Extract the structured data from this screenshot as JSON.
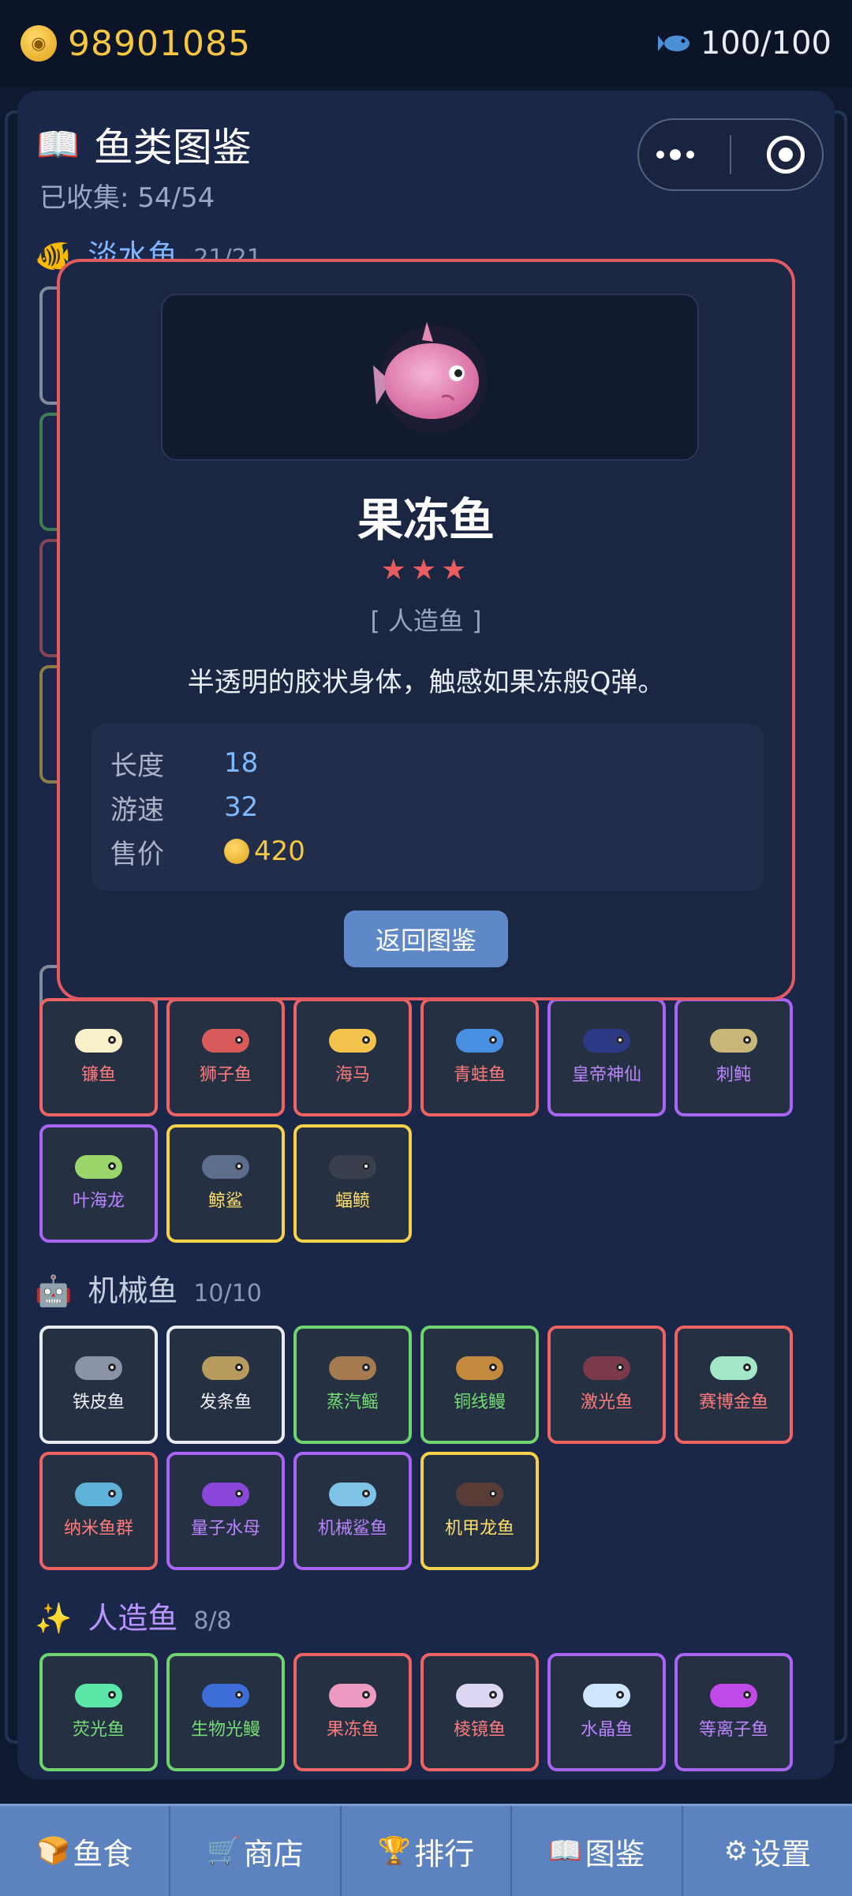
{
  "topbar": {
    "coins": "98901085",
    "fish_capacity": "100/100"
  },
  "album": {
    "title": "鱼类图鉴",
    "collected": "已收集: 54/54",
    "sections": {
      "freshwater": {
        "name": "淡水鱼",
        "count": "21/21"
      },
      "mechanical": {
        "name": "机械鱼",
        "count": "10/10"
      },
      "artificial": {
        "name": "人造鱼",
        "count": "8/8"
      }
    },
    "sea_row1": [
      {
        "name": "镰鱼",
        "rarity": "red",
        "color": "#f7f0c8"
      },
      {
        "name": "狮子鱼",
        "rarity": "red",
        "color": "#d85a5a"
      },
      {
        "name": "海马",
        "rarity": "red",
        "color": "#f3c24b"
      },
      {
        "name": "青蛙鱼",
        "rarity": "red",
        "color": "#4a90e2"
      },
      {
        "name": "皇帝神仙",
        "rarity": "purple",
        "color": "#2c3a86"
      },
      {
        "name": "刺鲀",
        "rarity": "purple",
        "color": "#c9b77a"
      }
    ],
    "sea_row2": [
      {
        "name": "叶海龙",
        "rarity": "purple",
        "color": "#9ad66a"
      },
      {
        "name": "鲸鲨",
        "rarity": "gold",
        "color": "#5d6e8c"
      },
      {
        "name": "蝠鲼",
        "rarity": "gold",
        "color": "#3a3f4d"
      }
    ],
    "mech_row1": [
      {
        "name": "铁皮鱼",
        "rarity": "white",
        "color": "#8a94a6"
      },
      {
        "name": "发条鱼",
        "rarity": "white",
        "color": "#b79a5e"
      },
      {
        "name": "蒸汽鳐",
        "rarity": "green",
        "color": "#a57a4f"
      },
      {
        "name": "铜线鳗",
        "rarity": "green",
        "color": "#c48a3e"
      },
      {
        "name": "激光鱼",
        "rarity": "red",
        "color": "#7a3a4a"
      },
      {
        "name": "赛博金鱼",
        "rarity": "red",
        "color": "#a3e6c8"
      }
    ],
    "mech_row2": [
      {
        "name": "纳米鱼群",
        "rarity": "red",
        "color": "#5fb2d8"
      },
      {
        "name": "量子水母",
        "rarity": "purple",
        "color": "#8a46d8"
      },
      {
        "name": "机械鲨鱼",
        "rarity": "purple",
        "color": "#7fc4e8"
      },
      {
        "name": "机甲龙鱼",
        "rarity": "gold",
        "color": "#5a3c36"
      }
    ],
    "art_row1": [
      {
        "name": "荧光鱼",
        "rarity": "green",
        "color": "#5ce6a8"
      },
      {
        "name": "生物光鳗",
        "rarity": "green",
        "color": "#3d6ed8"
      },
      {
        "name": "果冻鱼",
        "rarity": "red",
        "color": "#ee9ac2"
      },
      {
        "name": "棱镜鱼",
        "rarity": "red",
        "color": "#dcd6f2"
      },
      {
        "name": "水晶鱼",
        "rarity": "purple",
        "color": "#cfe6ff"
      },
      {
        "name": "等离子鱼",
        "rarity": "purple",
        "color": "#c04ae8"
      }
    ]
  },
  "modal": {
    "name": "果冻鱼",
    "stars": "★★★",
    "star_count": 3,
    "category": "[ 人造鱼 ]",
    "description": "半透明的胶状身体，触感如果冻般Q弹。",
    "stats": {
      "length_label": "长度",
      "length_value": "18",
      "speed_label": "游速",
      "speed_value": "32",
      "price_label": "售价",
      "price_value": "420"
    },
    "back_label": "返回图鉴",
    "accent": "#e05a5f"
  },
  "tabs": [
    {
      "icon": "bread-icon",
      "label": "鱼食"
    },
    {
      "icon": "cart-icon",
      "label": "商店"
    },
    {
      "icon": "trophy-icon",
      "label": "排行"
    },
    {
      "icon": "book-icon",
      "label": "图鉴"
    },
    {
      "icon": "gear-icon",
      "label": "设置"
    }
  ]
}
